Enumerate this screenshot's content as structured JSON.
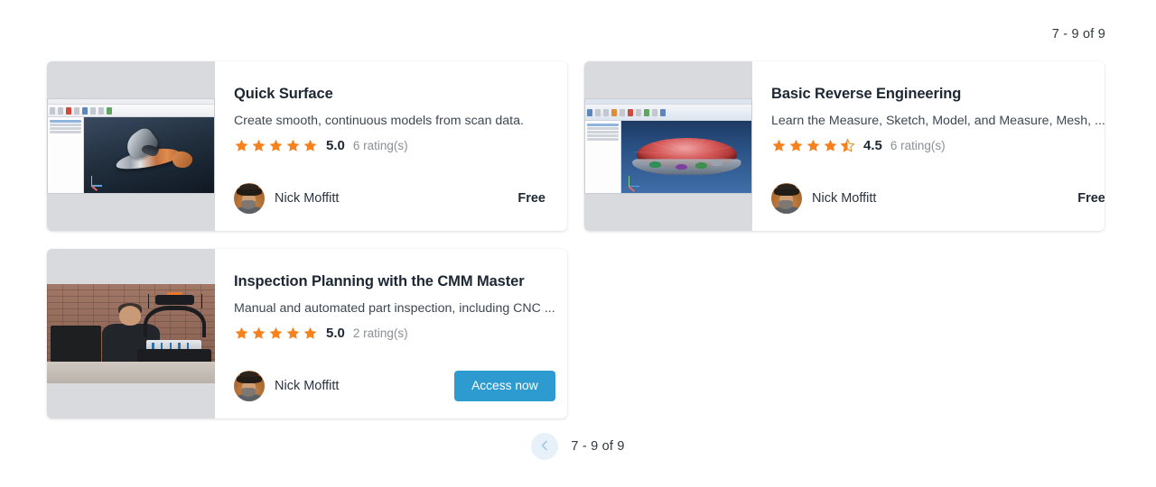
{
  "header": {
    "result_count": "7 - 9 of 9"
  },
  "cards": [
    {
      "title": "Quick Surface",
      "description": "Create smooth, continuous models from scan data.",
      "rating_value": "5.0",
      "rating_count": "6 rating(s)",
      "rating_number": 5.0,
      "author": "Nick Moffitt",
      "price_label": "Free",
      "action_label": null,
      "thumbnail": "cad-shark-screenshot"
    },
    {
      "title": "Basic Reverse Engineering",
      "description": "Learn the Measure, Sketch, Model, and Measure, Mesh, ...",
      "rating_value": "4.5",
      "rating_count": "6 rating(s)",
      "rating_number": 4.5,
      "author": "Nick Moffitt",
      "price_label": "Free",
      "action_label": null,
      "thumbnail": "cad-dome-screenshot"
    },
    {
      "title": "Inspection Planning with the CMM Master",
      "description": "Manual and automated part inspection, including CNC ...",
      "rating_value": "5.0",
      "rating_count": "2 rating(s)",
      "rating_number": 5.0,
      "author": "Nick Moffitt",
      "price_label": null,
      "action_label": "Access now",
      "thumbnail": "cmm-photo"
    }
  ],
  "pagination": {
    "prev_icon": "chevron-left-icon",
    "label": "7 - 9 of 9"
  },
  "colors": {
    "star": "#f5821f",
    "button": "#2e9bd0",
    "pager_circle": "#e9f1f8",
    "pager_chevron": "#9ecbe8"
  }
}
